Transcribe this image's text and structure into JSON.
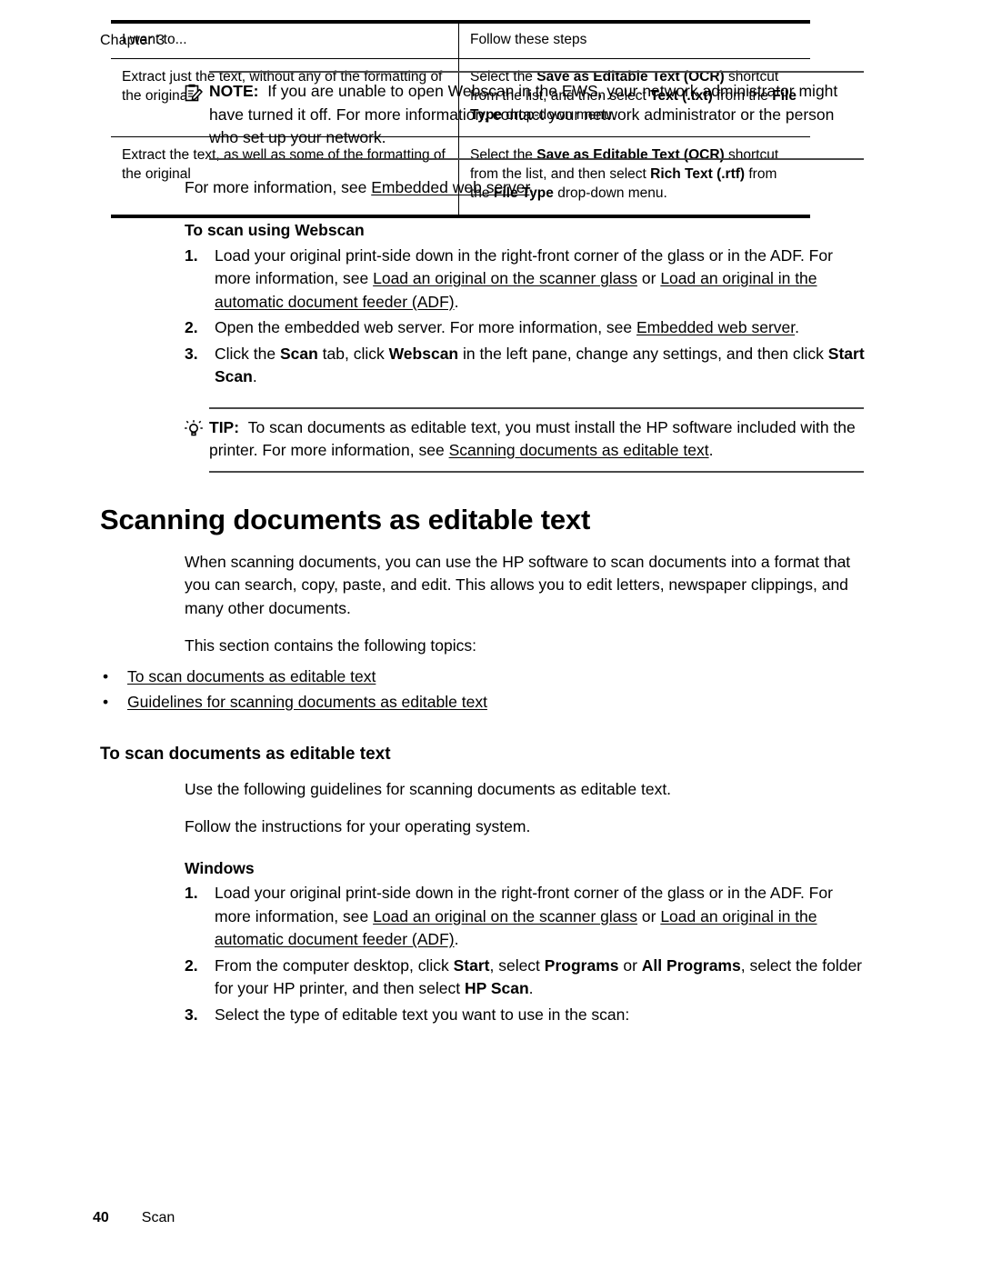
{
  "running_head": "Chapter 3",
  "note": {
    "icon": "note-clipboard-pencil-icon",
    "label": "NOTE:",
    "text": "If you are unable to open Webscan in the EWS, your network administrator might have turned it off. For more information, contact your network administrator or the person who set up your network."
  },
  "after_note": {
    "lead": "For more information, see ",
    "link": "Embedded web server",
    "tail": "."
  },
  "webscan_procedure": {
    "title": "To scan using Webscan",
    "steps": [
      {
        "num": "1.",
        "seg1": "Load your original print-side down in the right-front corner of the glass or in the ADF. For more information, see ",
        "link1": "Load an original on the scanner glass",
        "seg2": " or ",
        "link2": "Load an original in the automatic document feeder (ADF)",
        "seg3": "."
      },
      {
        "num": "2.",
        "seg1": "Open the embedded web server. For more information, see ",
        "link1": "Embedded web server",
        "seg2": "."
      },
      {
        "num": "3.",
        "seg1": "Click the ",
        "bold1": "Scan",
        "seg2": " tab, click ",
        "bold2": "Webscan",
        "seg3": " in the left pane, change any settings, and then click ",
        "bold3": "Start Scan",
        "seg4": "."
      }
    ]
  },
  "tip": {
    "icon": "tip-lightbulb-icon",
    "label": "TIP:",
    "seg1": "To scan documents as editable text, you must install the HP software included with the printer. For more information, see ",
    "link": "Scanning documents as editable text",
    "seg2": "."
  },
  "section": {
    "title": "Scanning documents as editable text",
    "paragraphs": [
      "When scanning documents, you can use the HP software to scan documents into a format that you can search, copy, paste, and edit. This allows you to edit letters, newspaper clippings, and many other documents.",
      "This section contains the following topics:"
    ],
    "topics": [
      "To scan documents as editable text",
      "Guidelines for scanning documents as editable text"
    ]
  },
  "subsection": {
    "title": "To scan documents as editable text",
    "paragraphs": [
      "Use the following guidelines for scanning documents as editable text.",
      "Follow the instructions for your operating system."
    ],
    "os_title": "Windows",
    "steps": [
      {
        "num": "1.",
        "seg1": "Load your original print-side down in the right-front corner of the glass or in the ADF. For more information, see ",
        "link1": "Load an original on the scanner glass",
        "seg2": " or ",
        "link2": "Load an original in the automatic document feeder (ADF)",
        "seg3": "."
      },
      {
        "num": "2.",
        "seg1": "From the computer desktop, click ",
        "bold1": "Start",
        "seg2": ", select ",
        "bold2": "Programs",
        "seg3": " or ",
        "bold3": "All Programs",
        "seg4": ", select the folder for your HP printer, and then select ",
        "bold4": "HP Scan",
        "seg5": "."
      },
      {
        "num": "3.",
        "seg1": "Select the type of editable text you want to use in the scan:"
      }
    ]
  },
  "table": {
    "headers": [
      "I want to...",
      "Follow these steps"
    ],
    "rows": [
      {
        "want": "Extract just the text, without any of the formatting of the original",
        "steps_seg1": "Select the ",
        "steps_bold1": "Save as Editable Text (OCR)",
        "steps_seg2": " shortcut from the list, and then select ",
        "steps_bold2": "Text (.txt)",
        "steps_seg3": " from the ",
        "steps_bold3": "File Type",
        "steps_seg4": " drop-down menu."
      },
      {
        "want": "Extract the text, as well as some of the formatting of the original",
        "steps_seg1": "Select the ",
        "steps_bold1": "Save as Editable Text (OCR)",
        "steps_seg2": " shortcut from the list, and then select ",
        "steps_bold2": "Rich Text (.rtf)",
        "steps_seg3": " from the ",
        "steps_bold3": "File Type",
        "steps_seg4": " drop-down menu."
      }
    ]
  },
  "footer": {
    "page_number": "40",
    "section_name": "Scan"
  }
}
